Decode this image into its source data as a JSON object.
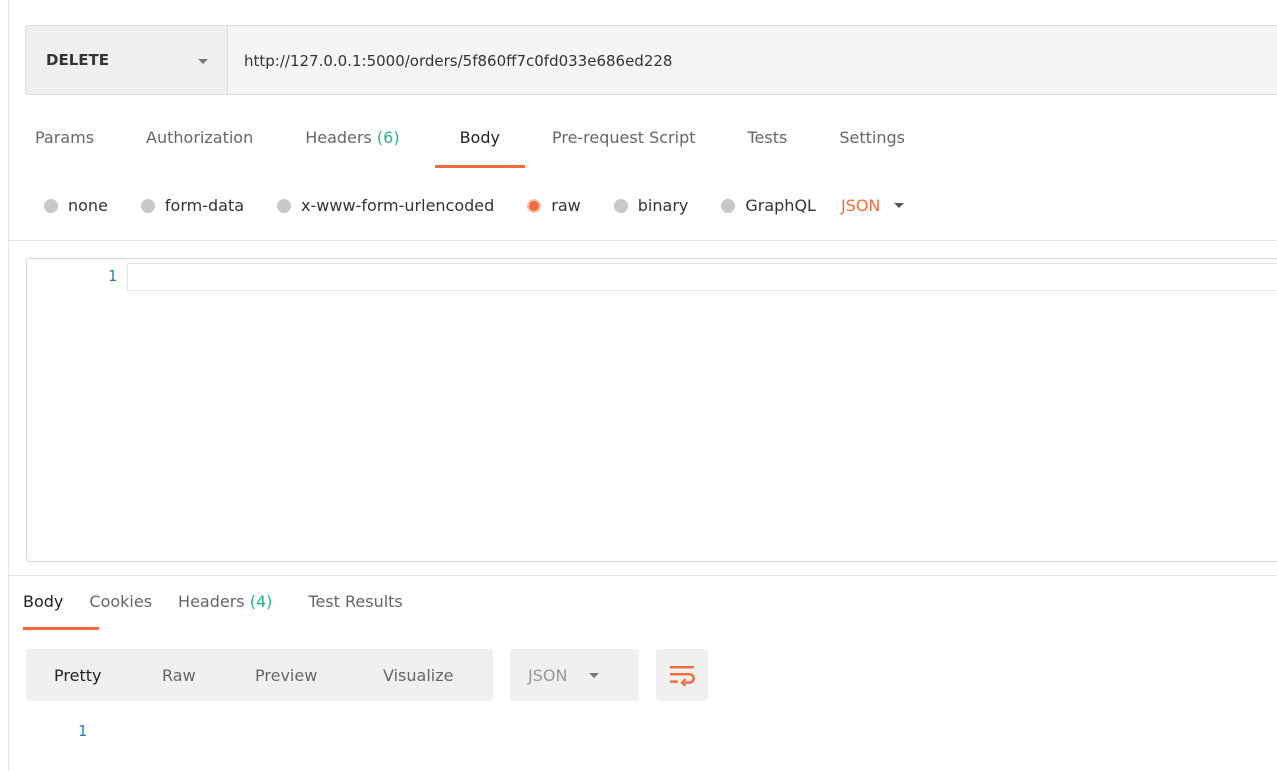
{
  "request": {
    "method": "DELETE",
    "url": "http://127.0.0.1:5000/orders/5f860ff7c0fd033e686ed228"
  },
  "request_tabs": [
    {
      "label": "Params",
      "count": ""
    },
    {
      "label": "Authorization",
      "count": ""
    },
    {
      "label": "Headers ",
      "count": "(6)"
    },
    {
      "label": "Body",
      "count": ""
    },
    {
      "label": "Pre-request Script",
      "count": ""
    },
    {
      "label": "Tests",
      "count": ""
    },
    {
      "label": "Settings",
      "count": ""
    }
  ],
  "active_request_tab": "Body",
  "body_types": [
    "none",
    "form-data",
    "x-www-form-urlencoded",
    "raw",
    "binary",
    "GraphQL"
  ],
  "selected_body_type": "raw",
  "body_language": "JSON",
  "editor": {
    "line_numbers": [
      "1"
    ]
  },
  "response_tabs": [
    {
      "label": "Body",
      "count": ""
    },
    {
      "label": "Cookies",
      "count": ""
    },
    {
      "label": "Headers ",
      "count": "(4)"
    },
    {
      "label": "Test Results",
      "count": ""
    }
  ],
  "active_response_tab": "Body",
  "response_views": [
    "Pretty",
    "Raw",
    "Preview",
    "Visualize"
  ],
  "active_response_view": "Pretty",
  "response_format": "JSON",
  "response_body": {
    "line_numbers": [
      "1"
    ]
  },
  "colors": {
    "accent": "#f26b3a",
    "count_green": "#26b47f",
    "line_number_blue": "#2a7fa9"
  },
  "icons": {
    "wrap": "wrap-lines-icon",
    "dropdown": "chevron-down-icon"
  }
}
